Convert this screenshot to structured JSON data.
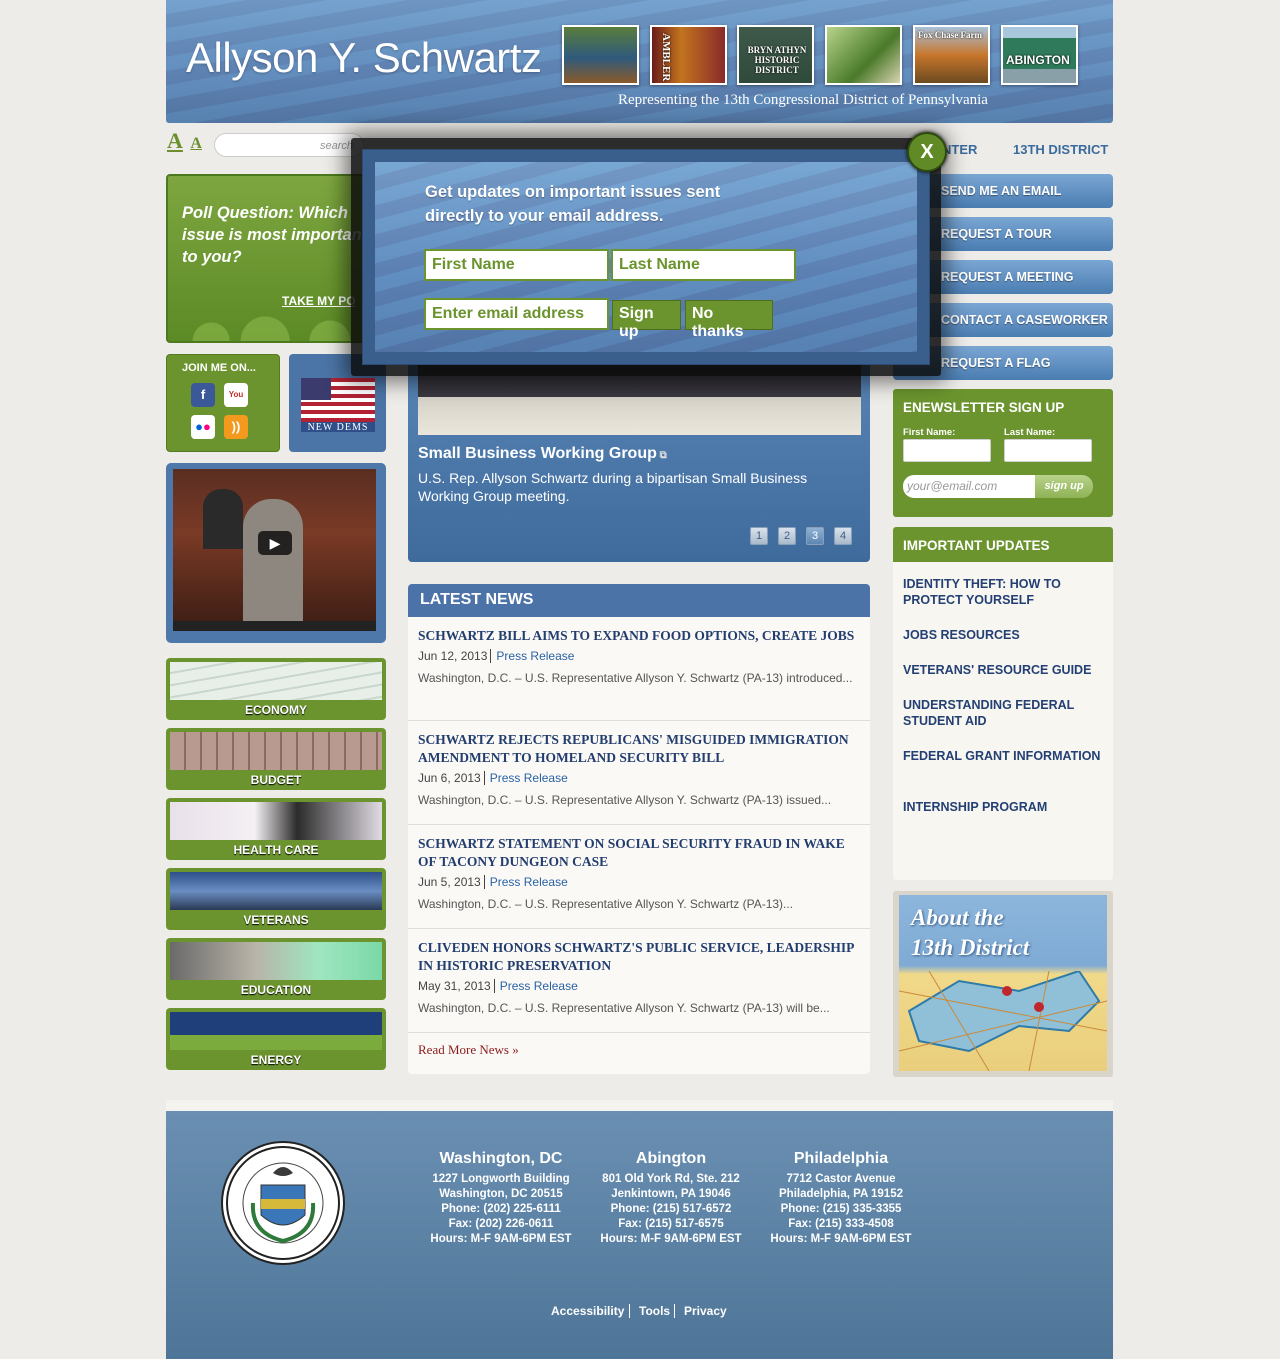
{
  "header": {
    "title": "Allyson Y. Schwartz",
    "tagline": "Representing the 13th Congressional District of Pennsylvania",
    "thumbnails": [
      "",
      "AMBLER",
      "BRYN ATHYN HISTORIC DISTRICT",
      "",
      "Fox Chase Farm",
      "ABINGTON"
    ]
  },
  "toolbar": {
    "font_large": "A",
    "font_small": "A",
    "search_placeholder": "search"
  },
  "nav": {
    "item_partial": "NTER",
    "district": "13TH DISTRICT"
  },
  "right_buttons": [
    "SEND ME AN EMAIL",
    "REQUEST A TOUR",
    "REQUEST A MEETING",
    "CONTACT A CASEWORKER",
    "REQUEST A FLAG"
  ],
  "poll": {
    "question": "Poll Question: Which issue is most important to you?",
    "link": "TAKE MY PO"
  },
  "join": {
    "title": "JOIN ME ON..."
  },
  "newdems": {
    "label": "NEW DEMS"
  },
  "issues": [
    "ECONOMY",
    "BUDGET",
    "HEALTH CARE",
    "VETERANS",
    "EDUCATION",
    "ENERGY"
  ],
  "slider": {
    "title": "Small Business Working Group",
    "description": "U.S. Rep. Allyson Schwartz during a bipartisan Small Business Working Group meeting.",
    "pages": [
      "1",
      "2",
      "3",
      "4"
    ]
  },
  "news": {
    "header": "LATEST NEWS",
    "items": [
      {
        "title": "SCHWARTZ BILL AIMS TO EXPAND FOOD OPTIONS, CREATE JOBS",
        "date": "Jun 12, 2013",
        "type": "Press Release",
        "summary": "Washington, D.C. – U.S. Representative Allyson Y. Schwartz (PA-13) introduced..."
      },
      {
        "title": "SCHWARTZ REJECTS REPUBLICANS' MISGUIDED IMMIGRATION AMENDMENT TO HOMELAND SECURITY BILL",
        "date": "Jun 6, 2013",
        "type": "Press Release",
        "summary": "Washington, D.C. – U.S. Representative Allyson Y. Schwartz (PA-13) issued..."
      },
      {
        "title": "SCHWARTZ STATEMENT ON SOCIAL SECURITY FRAUD IN WAKE OF TACONY DUNGEON CASE",
        "date": "Jun 5, 2013",
        "type": "Press Release",
        "summary": "Washington, D.C. – U.S. Representative Allyson Y. Schwartz (PA-13)..."
      },
      {
        "title": "CLIVEDEN HONORS SCHWARTZ'S PUBLIC SERVICE, LEADERSHIP IN HISTORIC PRESERVATION",
        "date": "May 31, 2013",
        "type": "Press Release",
        "summary": "Washington, D.C. – U.S. Representative Allyson Y. Schwartz (PA-13) will be..."
      }
    ],
    "more": "Read More News »"
  },
  "enews": {
    "title": "ENEWSLETTER SIGN UP",
    "first_label": "First Name:",
    "last_label": "Last Name:",
    "email_placeholder": "your@email.com",
    "button": "sign up"
  },
  "updates": {
    "title": "IMPORTANT UPDATES",
    "items": [
      "IDENTITY THEFT: HOW TO PROTECT YOURSELF",
      "JOBS RESOURCES",
      "VETERANS' RESOURCE GUIDE",
      "UNDERSTANDING FEDERAL STUDENT AID",
      "FEDERAL GRANT INFORMATION",
      "INTERNSHIP PROGRAM"
    ]
  },
  "about": {
    "title_line1": "About the",
    "title_line2": "13th District"
  },
  "footer": {
    "offices": [
      {
        "city": "Washington, DC",
        "lines": [
          "1227 Longworth Building",
          "Washington, DC 20515",
          "Phone: (202) 225-6111",
          "Fax: (202) 226-0611",
          "Hours: M-F 9AM-6PM EST"
        ]
      },
      {
        "city": "Abington",
        "lines": [
          "801 Old York Rd, Ste. 212",
          "Jenkintown, PA 19046",
          "Phone: (215) 517-6572",
          "Fax: (215) 517-6575",
          "Hours: M-F 9AM-6PM EST"
        ]
      },
      {
        "city": "Philadelphia",
        "lines": [
          "7712 Castor Avenue",
          "Philadelphia, PA 19152",
          "Phone: (215) 335-3355",
          "Fax: (215) 333-4508",
          "Hours: M-F 9AM-6PM EST"
        ]
      }
    ],
    "links": [
      "Accessibility",
      "Tools",
      "Privacy"
    ],
    "seal_text": "SEAL OF THE STATE OF PENNSYLVANIA"
  },
  "modal": {
    "headline": "Get updates on important issues sent directly to your email address.",
    "first_name": "First Name",
    "last_name": "Last Name",
    "email": "Enter email address",
    "signup": "Sign up",
    "no_thanks": "No thanks",
    "close": "X"
  },
  "colors": {
    "brand_green": "#6b942e",
    "brand_blue": "#4b73a7",
    "headline_navy": "#223d6e"
  }
}
